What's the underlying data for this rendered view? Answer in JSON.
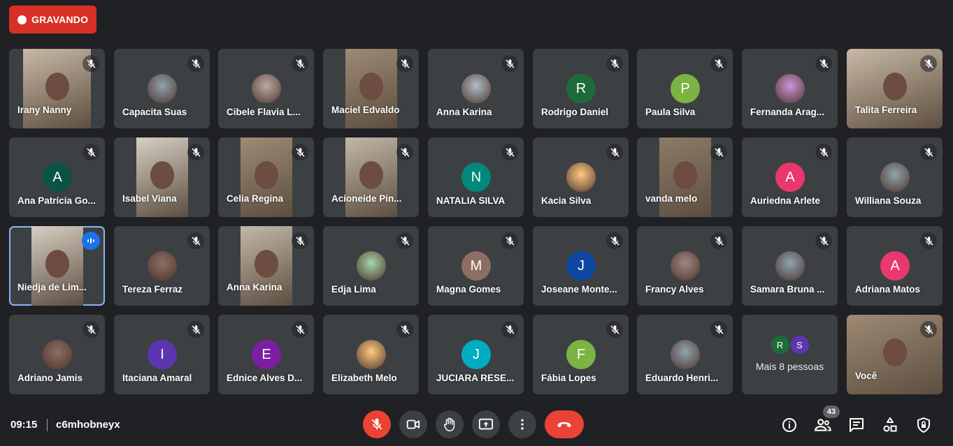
{
  "recording": {
    "label": "GRAVANDO"
  },
  "meeting": {
    "time": "09:15",
    "code": "c6mhobneyx",
    "participant_count": "43"
  },
  "colors": {
    "background": "#202124",
    "tile": "#3c4043",
    "danger": "#ea4335",
    "speaking": "#8ab4f8"
  },
  "tiles": [
    {
      "name": "Irany Nanny",
      "type": "video",
      "muted": true
    },
    {
      "name": "Capacita Suas",
      "type": "photo",
      "muted": true
    },
    {
      "name": "Cibele Flavia L...",
      "type": "photo",
      "muted": true
    },
    {
      "name": "Maciel Edvaldo",
      "type": "video",
      "muted": true
    },
    {
      "name": "Anna Karina",
      "type": "photo",
      "muted": true
    },
    {
      "name": "Rodrigo Daniel",
      "type": "initial",
      "initial": "R",
      "color": "#1e6b3a",
      "muted": true
    },
    {
      "name": "Paula Silva",
      "type": "initial",
      "initial": "P",
      "color": "#7cb342",
      "muted": true
    },
    {
      "name": "Fernanda Arag...",
      "type": "photo",
      "muted": true
    },
    {
      "name": "Talita Ferreira",
      "type": "video",
      "muted": true
    },
    {
      "name": "Ana Patrícia Go...",
      "type": "initial",
      "initial": "A",
      "color": "#0b5345",
      "muted": true
    },
    {
      "name": "Isabel Viana",
      "type": "video",
      "muted": true
    },
    {
      "name": "Celia Regina",
      "type": "video",
      "muted": true
    },
    {
      "name": "Acioneide Pin...",
      "type": "video",
      "muted": true
    },
    {
      "name": "NATALIA SILVA",
      "type": "initial",
      "initial": "N",
      "color": "#00897b",
      "muted": true
    },
    {
      "name": "Kacia Silva",
      "type": "photo",
      "muted": true
    },
    {
      "name": "vanda melo",
      "type": "video",
      "muted": true
    },
    {
      "name": "Auriedna Arlete",
      "type": "initial",
      "initial": "A",
      "color": "#e8386d",
      "muted": true
    },
    {
      "name": "Williana Souza",
      "type": "photo",
      "muted": true
    },
    {
      "name": "Niedja de Lim...",
      "type": "video",
      "muted": false,
      "speaking": true
    },
    {
      "name": "Tereza Ferraz",
      "type": "photo",
      "muted": true
    },
    {
      "name": "Anna Karina",
      "type": "video",
      "muted": true
    },
    {
      "name": "Edja Lima",
      "type": "photo",
      "muted": true
    },
    {
      "name": "Magna Gomes",
      "type": "initial",
      "initial": "M",
      "color": "#8d6e63",
      "muted": true
    },
    {
      "name": "Joseane Monte...",
      "type": "initial",
      "initial": "J",
      "color": "#0d47a1",
      "muted": true
    },
    {
      "name": "Francy Alves",
      "type": "photo",
      "muted": true
    },
    {
      "name": "Samara Bruna ...",
      "type": "photo",
      "muted": true
    },
    {
      "name": "Adriana Matos",
      "type": "initial",
      "initial": "A",
      "color": "#e8386d",
      "muted": true
    },
    {
      "name": "Adriano Jamis",
      "type": "photo",
      "muted": true
    },
    {
      "name": "Itaciana Amaral",
      "type": "initial",
      "initial": "I",
      "color": "#5e35b1",
      "muted": true
    },
    {
      "name": "Ednice Alves D...",
      "type": "initial",
      "initial": "E",
      "color": "#7b1fa2",
      "muted": true
    },
    {
      "name": "Elizabeth Melo",
      "type": "photo",
      "muted": true
    },
    {
      "name": "JUCIARA RESE...",
      "type": "initial",
      "initial": "J",
      "color": "#00acc1",
      "muted": true
    },
    {
      "name": "Fábia Lopes",
      "type": "initial",
      "initial": "F",
      "color": "#7cb342",
      "muted": true
    },
    {
      "name": "Eduardo Henri...",
      "type": "photo",
      "muted": true
    },
    {
      "name": "Mais 8 pessoas",
      "type": "more",
      "initials": [
        "R",
        "S"
      ],
      "colors": [
        "#1e6b3a",
        "#5e35b1"
      ]
    },
    {
      "name": "Você",
      "type": "video",
      "muted": true
    }
  ],
  "controls": {
    "mic": {
      "icon": "mic-off-icon"
    },
    "camera": {
      "icon": "camera-icon"
    },
    "hand": {
      "icon": "raise-hand-icon"
    },
    "present": {
      "icon": "present-screen-icon"
    },
    "more": {
      "icon": "more-vert-icon"
    },
    "leave": {
      "icon": "call-end-icon"
    },
    "right": [
      "info-icon",
      "people-icon",
      "chat-icon",
      "activities-icon",
      "host-controls-icon"
    ]
  }
}
